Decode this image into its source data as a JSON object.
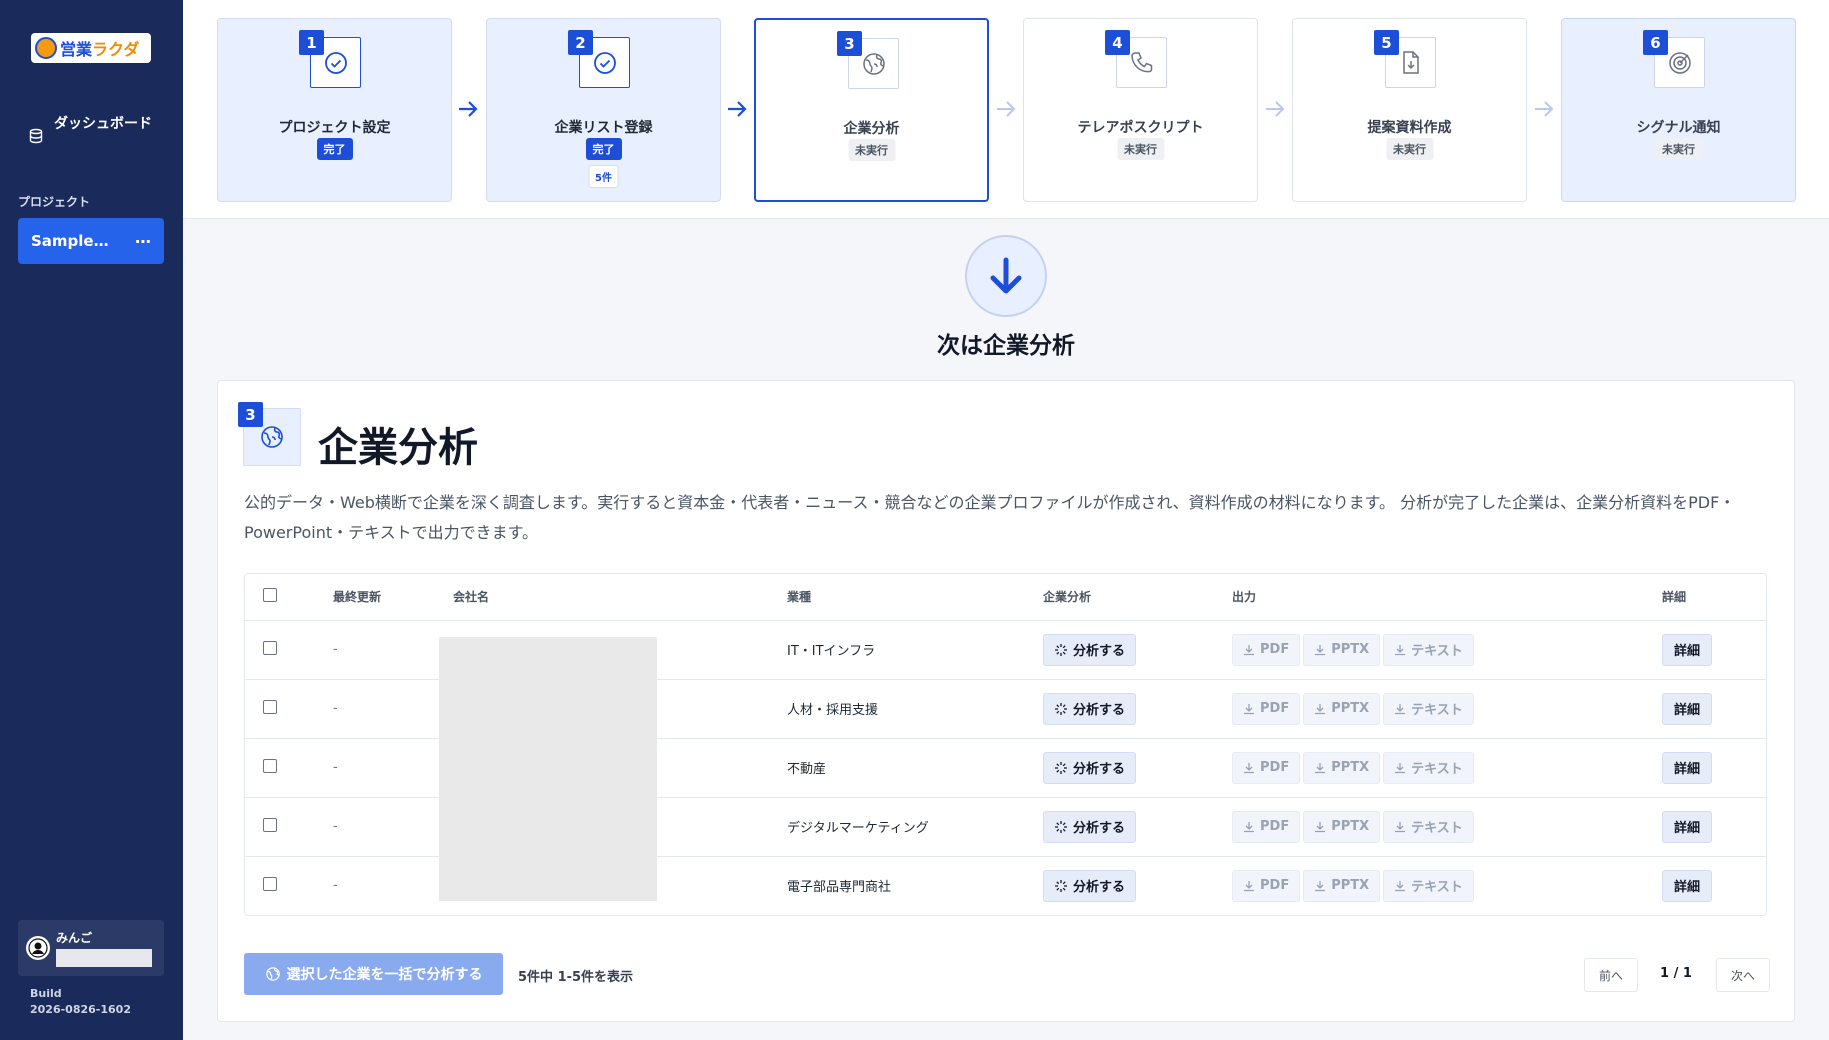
{
  "sidebar": {
    "logo_text": "営業",
    "logo_accent": "ラクダ",
    "dashboard_label": "ダッシュボード",
    "section_label": "プロジェクト",
    "project_name": "SampleGi…",
    "project_more": "⋯",
    "user_name": "みんご",
    "build_label": "Build",
    "build_id": "2026-0826-1602"
  },
  "steps": [
    {
      "num": "1",
      "title": "プロジェクト設定",
      "status": "完了",
      "icon": "check-circle-icon"
    },
    {
      "num": "2",
      "title": "企業リスト登録",
      "status": "完了",
      "count": "5件",
      "icon": "check-circle-icon"
    },
    {
      "num": "3",
      "title": "企業分析",
      "status": "未実行",
      "icon": "globe-icon"
    },
    {
      "num": "4",
      "title": "テレアポスクリプト",
      "status": "未実行",
      "icon": "phone-icon"
    },
    {
      "num": "5",
      "title": "提案資料作成",
      "status": "未実行",
      "icon": "document-download-icon"
    },
    {
      "num": "6",
      "title": "シグナル通知",
      "status": "未実行",
      "icon": "radar-icon"
    }
  ],
  "next": {
    "label": "次は企業分析"
  },
  "card": {
    "num": "3",
    "title": "企業分析",
    "description": "公的データ・Web横断で企業を深く調査します。実行すると資本金・代表者・ニュース・競合などの企業プロファイルが作成され、資料作成の材料になります。 分析が完了した企業は、企業分析資料をPDF・PowerPoint・テキストで出力できます。"
  },
  "table": {
    "headers": {
      "updated": "最終更新",
      "company": "会社名",
      "industry": "業種",
      "analysis": "企業分析",
      "output": "出力",
      "detail": "詳細"
    },
    "rows": [
      {
        "updated": "-",
        "industry": "IT・ITインフラ"
      },
      {
        "updated": "-",
        "industry": "人材・採用支援"
      },
      {
        "updated": "-",
        "industry": "不動産"
      },
      {
        "updated": "-",
        "industry": "デジタルマーケティング"
      },
      {
        "updated": "-",
        "industry": "電子部品専門商社"
      }
    ],
    "analyze_label": "分析する",
    "pdf_label": "PDF",
    "pptx_label": "PPTX",
    "text_label": "テキスト",
    "detail_label": "詳細"
  },
  "footer": {
    "bulk_label": "選択した企業を一括で分析する",
    "count_text": "5件中 1-5件を表示",
    "prev_label": "前へ",
    "page_indicator": "1 / 1",
    "next_label": "次へ"
  },
  "colors": {
    "sidebar": "#1a2a5a",
    "accent": "#1d4ed8",
    "done_bg": "#e8efff",
    "bulk_button": "#8aaaf0"
  }
}
